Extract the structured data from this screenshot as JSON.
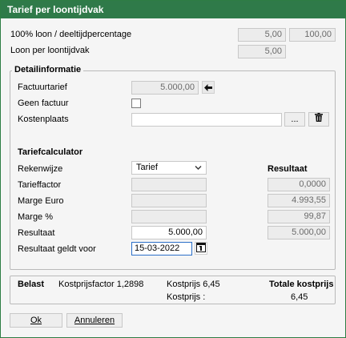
{
  "window": {
    "title": "Tarief per loontijdvak"
  },
  "top": {
    "row1_label": "100% loon / deeltijdpercentage",
    "row1_value1": "5,00",
    "row1_value2": "100,00",
    "row2_label": "Loon per loontijdvak",
    "row2_value": "5,00"
  },
  "detail": {
    "title": "Detailinformatie",
    "factuurtarief_label": "Factuurtarief",
    "factuurtarief_value": "5.000,00",
    "geen_factuur_label": "Geen factuur",
    "geen_factuur_checked": false,
    "kostenplaats_label": "Kostenplaats",
    "kostenplaats_value": "",
    "ellipsis_label": "...",
    "calc_title": "Tariefcalculator",
    "resultaat_header": "Resultaat",
    "rekenwijze_label": "Rekenwijze",
    "rekenwijze_value": "Tarief",
    "tarieffactor_label": "Tarieffactor",
    "tarieffactor_input": "",
    "tarieffactor_result": "0,0000",
    "marge_euro_label": "Marge Euro",
    "marge_euro_input": "",
    "marge_euro_result": "4.993,55",
    "marge_pct_label": "Marge %",
    "marge_pct_input": "",
    "marge_pct_result": "99,87",
    "resultaat_label": "Resultaat",
    "resultaat_input": "5.000,00",
    "resultaat_result": "5.000,00",
    "geldt_label": "Resultaat geldt voor",
    "geldt_value": "15-03-2022"
  },
  "summary": {
    "belast": "Belast",
    "kostprijsfactor": "Kostprijsfactor 1,2898",
    "kostprijs1": "Kostprijs 6,45",
    "totale_kostprijs": "Totale kostprijs",
    "kostprijs2_label": "Kostprijs :",
    "kostprijs2_value": "6,45"
  },
  "buttons": {
    "ok": "Ok",
    "annuleren": "Annuleren"
  },
  "icons": {
    "back": "arrow-left-icon",
    "delete": "trash-icon",
    "calendar": "calendar-icon"
  }
}
